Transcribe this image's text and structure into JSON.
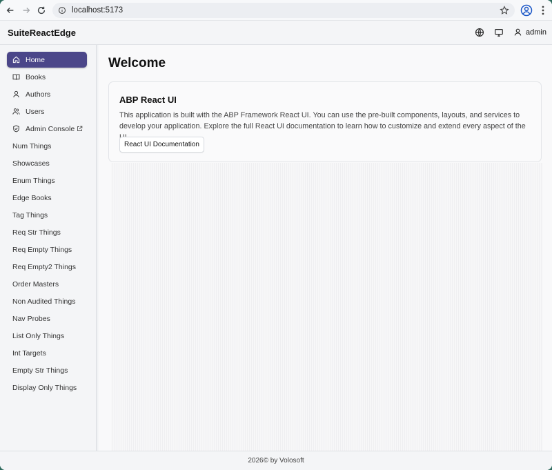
{
  "browser": {
    "url": "localhost:5173",
    "icons": {
      "back": "arrow-left-icon",
      "forward": "arrow-right-icon",
      "reload": "reload-icon",
      "site_info": "info-icon",
      "bookmark": "star-icon",
      "profile": "profile-icon",
      "menu": "kebab-menu-icon"
    }
  },
  "header": {
    "brand": "SuiteReactEdge",
    "user_name": "admin",
    "icons": [
      "globe-icon",
      "monitor-icon",
      "user-icon"
    ]
  },
  "sidebar": {
    "items": [
      {
        "label": "Home",
        "icon": "home-icon",
        "active": true
      },
      {
        "label": "Books",
        "icon": "book-icon"
      },
      {
        "label": "Authors",
        "icon": "user-icon"
      },
      {
        "label": "Users",
        "icon": "users-icon"
      },
      {
        "label": "Admin Console",
        "icon": "shield-icon",
        "external": true
      },
      {
        "label": "Num Things"
      },
      {
        "label": "Showcases"
      },
      {
        "label": "Enum Things"
      },
      {
        "label": "Edge Books"
      },
      {
        "label": "Tag Things"
      },
      {
        "label": "Req Str Things"
      },
      {
        "label": "Req Empty Things"
      },
      {
        "label": "Req Empty2 Things"
      },
      {
        "label": "Order Masters"
      },
      {
        "label": "Non Audited Things"
      },
      {
        "label": "Nav Probes"
      },
      {
        "label": "List Only Things"
      },
      {
        "label": "Int Targets"
      },
      {
        "label": "Empty Str Things"
      },
      {
        "label": "Display Only Things"
      }
    ],
    "active_color": "#4b4689"
  },
  "main": {
    "title": "Welcome",
    "card": {
      "title": "ABP React UI",
      "text": "This application is built with the ABP Framework React UI. You can use the pre-built components, layouts, and services to develop your application. Explore the full React UI documentation to learn how to customize and extend every aspect of the UI.",
      "button_label": "React UI Documentation"
    }
  },
  "footer": {
    "text": "2026© by Volosoft"
  }
}
